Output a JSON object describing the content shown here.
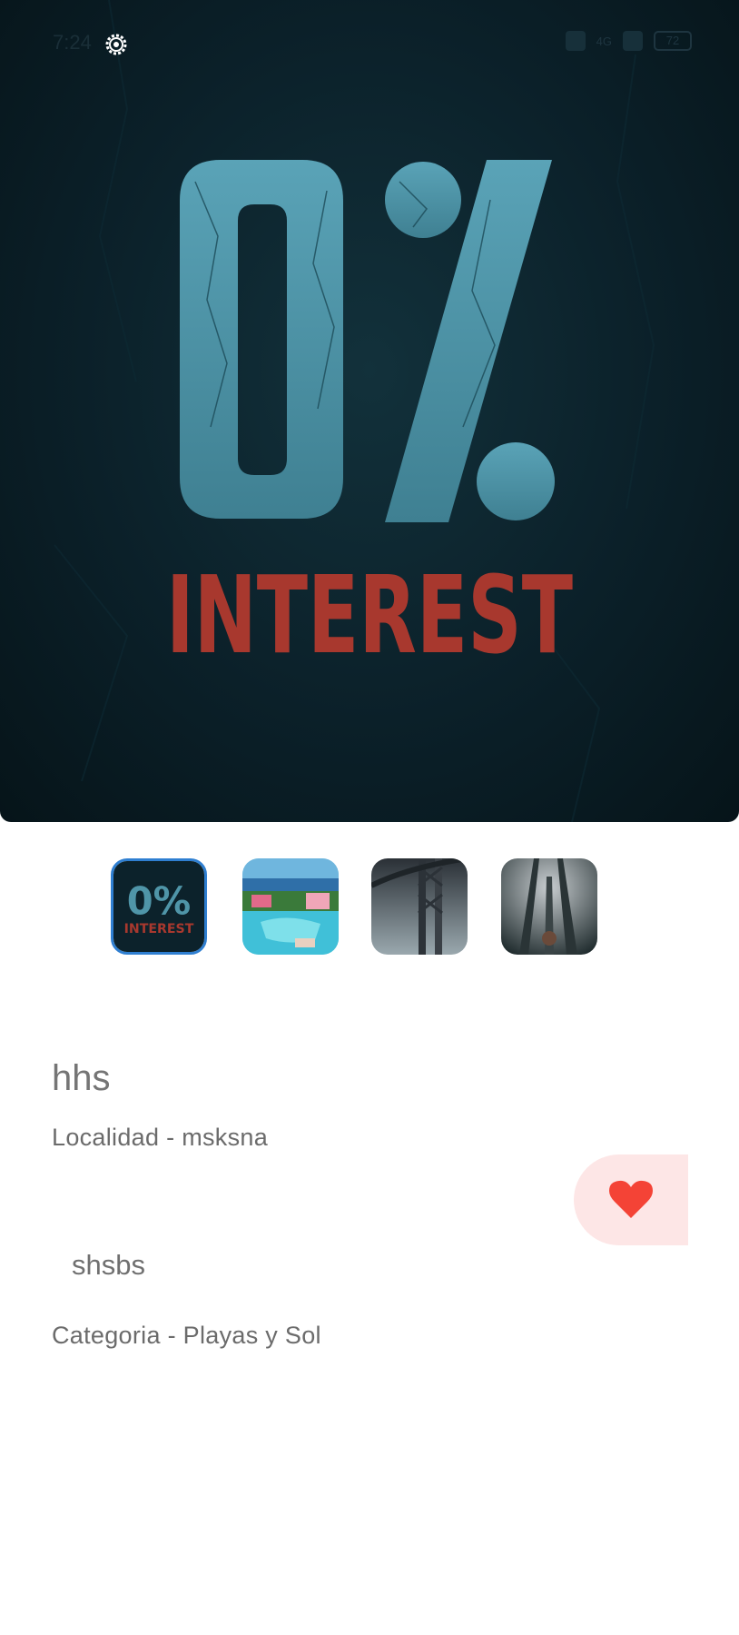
{
  "status_bar": {
    "time": "7:24",
    "battery": "72",
    "network": "4G",
    "icons": [
      "settings-gear-icon",
      "alarm-icon",
      "signal-icon",
      "battery-icon"
    ]
  },
  "hero": {
    "image_name": "hero-image-0-percent-interest",
    "big_text": "0%",
    "word_text": "INTEREST",
    "colors": {
      "background": "#0b2029",
      "numeral": "#4f95a8",
      "word": "#a8382e"
    }
  },
  "thumbnails": [
    {
      "name": "thumbnail-0-percent-interest",
      "label": "0%",
      "sub": "INTEREST",
      "selected": true
    },
    {
      "name": "thumbnail-beach-resort",
      "selected": false
    },
    {
      "name": "thumbnail-bridge-fog",
      "selected": false
    },
    {
      "name": "thumbnail-forest-dark",
      "selected": false
    }
  ],
  "details": {
    "title": "hhs",
    "locality": "Localidad - msksna",
    "subtitle": "shsbs",
    "category": "Categoria - Playas y Sol"
  },
  "favorite": {
    "icon": "heart-icon",
    "color": "#f44336",
    "background": "#fde6e6"
  }
}
